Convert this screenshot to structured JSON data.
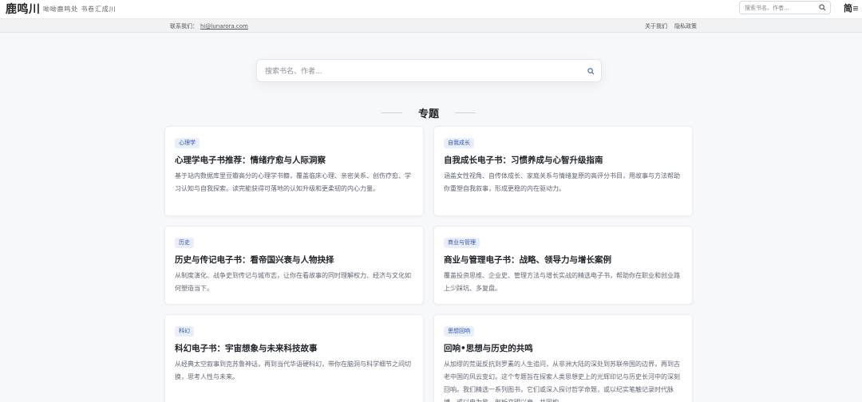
{
  "header": {
    "logo": "鹿鸣川",
    "slogan": "呦呦鹿鸣处 书卷汇成川",
    "search_placeholder": "搜索书名、作者...",
    "lang_toggle": "简"
  },
  "subbar": {
    "contact_label": "联系我们：",
    "contact_email": "hi@lunarora.com",
    "links": [
      "关于我们",
      "隐私政策"
    ]
  },
  "main_search": {
    "placeholder": "搜索书名、作者..."
  },
  "section": {
    "title": "专题"
  },
  "cards": [
    {
      "tag": "心理学",
      "title": "心理学电子书推荐：情绪疗愈与人际洞察",
      "desc": "基于站内数据库里豆瓣高分的心理学书籍，覆盖临床心理、亲密关系、创伤疗愈、学习认知与自我探索。读完能获得可落地的认知升级和更柔韧的内心力量。"
    },
    {
      "tag": "自我成长",
      "title": "自我成长电子书：习惯养成与心智升级指南",
      "desc": "涵盖女性视角、自传体成长、家庭关系与情绪复原的高评分书目，用故事与方法帮助你重塑自我叙事，形成更稳的内在驱动力。"
    },
    {
      "tag": "历史",
      "title": "历史与传记电子书：看帝国兴衰与人物抉择",
      "desc": "从制度演化、战争史到传记与城市志，让你在看故事的同时理解权力、经济与文化如何塑造当下。"
    },
    {
      "tag": "商业与管理",
      "title": "商业与管理电子书：战略、领导力与增长案例",
      "desc": "覆盖投资思维、企业史、管理方法与增长实战的精选电子书，帮助你在职业和创业路上少踩坑、多复盘。"
    },
    {
      "tag": "科幻",
      "title": "科幻电子书：宇宙想象与未来科技故事",
      "desc": "从经典太空叙事到克苏鲁神话，再到当代华语硬科幻，带你在脑洞与科学细节之间切换，思考人性与未来。"
    },
    {
      "tag": "思想回响",
      "title": "回响•思想与历史的共鸣",
      "desc": "从加缪的荒诞反抗到罗素的人生追问，从非洲大陆的深处到苏联帝国的边界，再到古老中国的风云变幻。这个专题旨在探索人类思想史上的光辉印记与历史长河中的深刻回响。我们精选一系列图书，它们或深入探讨哲学命题，或以纪实笔触记录时代脉搏，或以史为鉴，剖析文明兴衰，共同构"
    }
  ]
}
